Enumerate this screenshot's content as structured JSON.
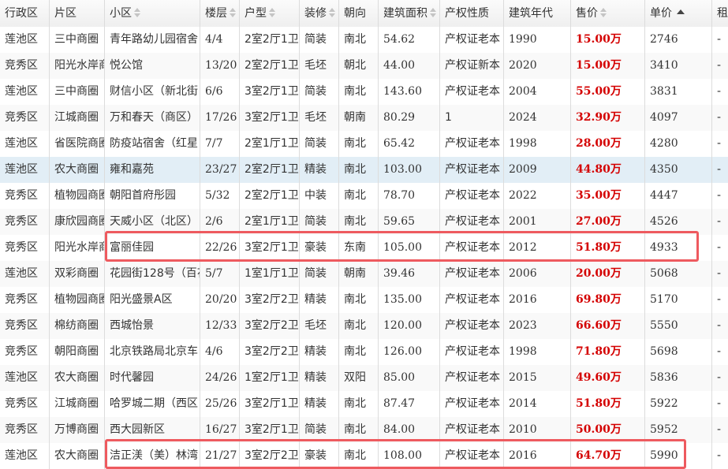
{
  "columns": [
    {
      "key": "district",
      "label": "行政区",
      "sort": "none"
    },
    {
      "key": "area",
      "label": "片区",
      "sort": "none"
    },
    {
      "key": "community",
      "label": "小区",
      "sort": "sortable"
    },
    {
      "key": "floor",
      "label": "楼层",
      "sort": "sortable"
    },
    {
      "key": "layout",
      "label": "户型",
      "sort": "sortable"
    },
    {
      "key": "decoration",
      "label": "装修",
      "sort": "sortable"
    },
    {
      "key": "orientation",
      "label": "朝向",
      "sort": "none"
    },
    {
      "key": "size",
      "label": "建筑面积",
      "sort": "sortable"
    },
    {
      "key": "ownership",
      "label": "产权性质",
      "sort": "none"
    },
    {
      "key": "year",
      "label": "建筑年代",
      "sort": "none"
    },
    {
      "key": "price",
      "label": "售价",
      "sort": "sortable"
    },
    {
      "key": "unit_price",
      "label": "单价",
      "sort": "ascending"
    },
    {
      "key": "rent",
      "label": "租",
      "sort": "none"
    }
  ],
  "rows": [
    {
      "district": "莲池区",
      "area": "三中商圈",
      "community": "青年路幼儿园宿舍",
      "floor": "4/4",
      "layout": "2室2厅1卫",
      "decoration": "简装",
      "orientation": "南北",
      "size": "54.62",
      "ownership": "产权证老本",
      "year": "1990",
      "price": "15.00万",
      "unit_price": "2746",
      "rent": "-"
    },
    {
      "district": "竞秀区",
      "area": "阳光水岸商",
      "community": "悦公馆",
      "floor": "13/20",
      "layout": "2室2厅1卫",
      "decoration": "毛坯",
      "orientation": "朝北",
      "size": "44.00",
      "ownership": "产权证新本",
      "year": "2020",
      "price": "15.00万",
      "unit_price": "3410",
      "rent": "-"
    },
    {
      "district": "莲池区",
      "area": "三中商圈",
      "community": "财信小区（新北街",
      "floor": "6/6",
      "layout": "3室2厅1卫",
      "decoration": "简装",
      "orientation": "南北",
      "size": "143.60",
      "ownership": "产权证老本",
      "year": "2004",
      "price": "55.00万",
      "unit_price": "3831",
      "rent": "-"
    },
    {
      "district": "竞秀区",
      "area": "江城商圈",
      "community": "万和春天（商区）",
      "floor": "17/26",
      "layout": "3室2厅1卫",
      "decoration": "毛坯",
      "orientation": "朝南",
      "size": "80.29",
      "ownership": "1",
      "year": "2024",
      "price": "32.90万",
      "unit_price": "4097",
      "rent": "-"
    },
    {
      "district": "莲池区",
      "area": "省医院商圈",
      "community": "防疫站宿舍（红星",
      "floor": "7/7",
      "layout": "2室1厅1卫",
      "decoration": "简装",
      "orientation": "南北",
      "size": "65.42",
      "ownership": "产权证老本",
      "year": "1998",
      "price": "28.00万",
      "unit_price": "4280",
      "rent": "-"
    },
    {
      "district": "莲池区",
      "area": "农大商圈",
      "community": "雍和嘉苑",
      "floor": "23/27",
      "layout": "2室2厅1卫",
      "decoration": "精装",
      "orientation": "南北",
      "size": "103.00",
      "ownership": "产权证老本",
      "year": "2009",
      "price": "44.80万",
      "unit_price": "4350",
      "rent": "-"
    },
    {
      "district": "竞秀区",
      "area": "植物园商圈",
      "community": "朝阳首府彤园",
      "floor": "5/32",
      "layout": "2室2厅1卫",
      "decoration": "中装",
      "orientation": "南北",
      "size": "78.70",
      "ownership": "产权证老本",
      "year": "2022",
      "price": "35.00万",
      "unit_price": "4447",
      "rent": "-"
    },
    {
      "district": "竞秀区",
      "area": "康欣园商圈",
      "community": "天威小区（北区）",
      "floor": "2/6",
      "layout": "2室1厅1卫",
      "decoration": "简装",
      "orientation": "南北",
      "size": "59.65",
      "ownership": "产权证老本",
      "year": "2001",
      "price": "27.00万",
      "unit_price": "4526",
      "rent": "-"
    },
    {
      "district": "竞秀区",
      "area": "阳光水岸商",
      "community": "富丽佳园",
      "floor": "22/26",
      "layout": "3室2厅1卫",
      "decoration": "豪装",
      "orientation": "东南",
      "size": "105.00",
      "ownership": "产权证老本",
      "year": "2012",
      "price": "51.80万",
      "unit_price": "4933",
      "rent": "-"
    },
    {
      "district": "莲池区",
      "area": "双彩商圈",
      "community": "花园街128号（百花",
      "floor": "5/7",
      "layout": "1室1厅1卫",
      "decoration": "简装",
      "orientation": "朝南",
      "size": "39.46",
      "ownership": "产权证老本",
      "year": "2006",
      "price": "20.00万",
      "unit_price": "5068",
      "rent": "-"
    },
    {
      "district": "竞秀区",
      "area": "植物园商圈",
      "community": "阳光盛景A区",
      "floor": "20/20",
      "layout": "3室2厅2卫",
      "decoration": "精装",
      "orientation": "南北",
      "size": "135.00",
      "ownership": "产权证老本",
      "year": "2016",
      "price": "69.80万",
      "unit_price": "5170",
      "rent": "-"
    },
    {
      "district": "竞秀区",
      "area": "棉纺商圈",
      "community": "西城怡景",
      "floor": "12/33",
      "layout": "3室2厅2卫",
      "decoration": "毛坯",
      "orientation": "南北",
      "size": "120.00",
      "ownership": "产权证老本",
      "year": "2023",
      "price": "66.60万",
      "unit_price": "5550",
      "rent": "-"
    },
    {
      "district": "竞秀区",
      "area": "朝阳商圈",
      "community": "北京铁路局北京车",
      "floor": "4/6",
      "layout": "3室2厅2卫",
      "decoration": "精装",
      "orientation": "南北",
      "size": "126.00",
      "ownership": "产权证老本",
      "year": "1998",
      "price": "71.80万",
      "unit_price": "5698",
      "rent": "-"
    },
    {
      "district": "莲池区",
      "area": "农大商圈",
      "community": "时代馨园",
      "floor": "24/26",
      "layout": "1室2厅1卫",
      "decoration": "精装",
      "orientation": "双阳",
      "size": "85.00",
      "ownership": "产权证老本",
      "year": "2015",
      "price": "49.60万",
      "unit_price": "5836",
      "rent": "-"
    },
    {
      "district": "竞秀区",
      "area": "江城商圈",
      "community": "哈罗城二期（西区",
      "floor": "25/26",
      "layout": "3室2厅1卫",
      "decoration": "精装",
      "orientation": "南北",
      "size": "87.47",
      "ownership": "产权证老本",
      "year": "2014",
      "price": "51.80万",
      "unit_price": "5922",
      "rent": "-"
    },
    {
      "district": "竞秀区",
      "area": "万博商圈",
      "community": "西大园新区",
      "floor": "16/27",
      "layout": "3室2厅1卫",
      "decoration": "简装",
      "orientation": "南北",
      "size": "84.00",
      "ownership": "产权证老本",
      "year": "2010",
      "price": "50.00万",
      "unit_price": "5952",
      "rent": "-"
    },
    {
      "district": "莲池区",
      "area": "农大商圈",
      "community": "洁正渼（美）林湾",
      "floor": "21/27",
      "layout": "3室2厅2卫",
      "decoration": "豪装",
      "orientation": "南北",
      "size": "108.00",
      "ownership": "产权证老本",
      "year": "2016",
      "price": "64.70万",
      "unit_price": "5990",
      "rent": "-"
    }
  ],
  "selected_row": 5,
  "highlight_color": "#ee5a5f",
  "price_color": "#d40000"
}
